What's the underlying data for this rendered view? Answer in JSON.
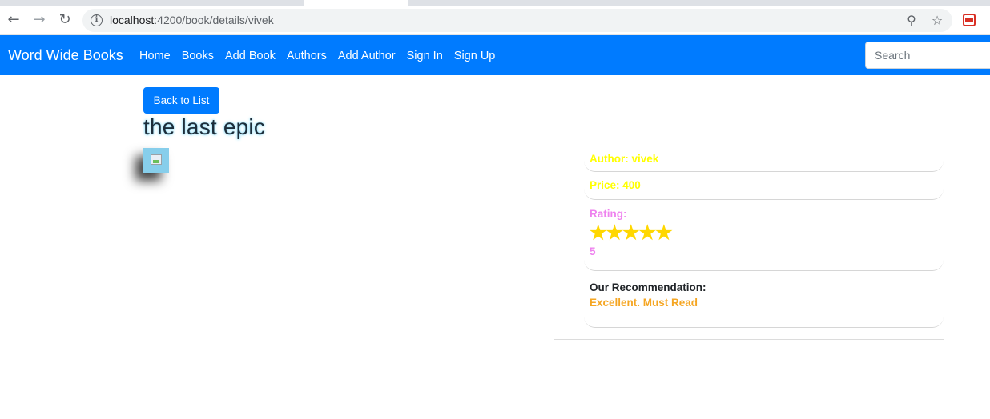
{
  "browser": {
    "url_host": "localhost",
    "url_path": ":4200/book/details/vivek",
    "icons": [
      "back-arrow-icon",
      "forward-arrow-icon",
      "reload-icon",
      "info-icon",
      "zoom-icon",
      "star-icon",
      "extension-icon"
    ]
  },
  "navbar": {
    "brand": "Word Wide Books",
    "links": [
      "Home",
      "Books",
      "Add Book",
      "Authors",
      "Add Author",
      "Sign In",
      "Sign Up"
    ],
    "search_placeholder": "Search",
    "bg_color": "#007bff"
  },
  "book": {
    "back_label": "Back to List",
    "title": "the last epic",
    "author_line": "Author: vivek",
    "price_line": "Price: 400",
    "rating_label": "Rating:",
    "rating": 5,
    "rating_max": 5,
    "rating_value": "5",
    "recommendation_label": "Our Recommendation:",
    "recommendation_value": "Excellent. Must Read"
  },
  "colors": {
    "author": "#ffff00",
    "price": "#ffff00",
    "rating": "#ee82ee",
    "star": "#ffd700",
    "recommendation": "#f5a623"
  }
}
